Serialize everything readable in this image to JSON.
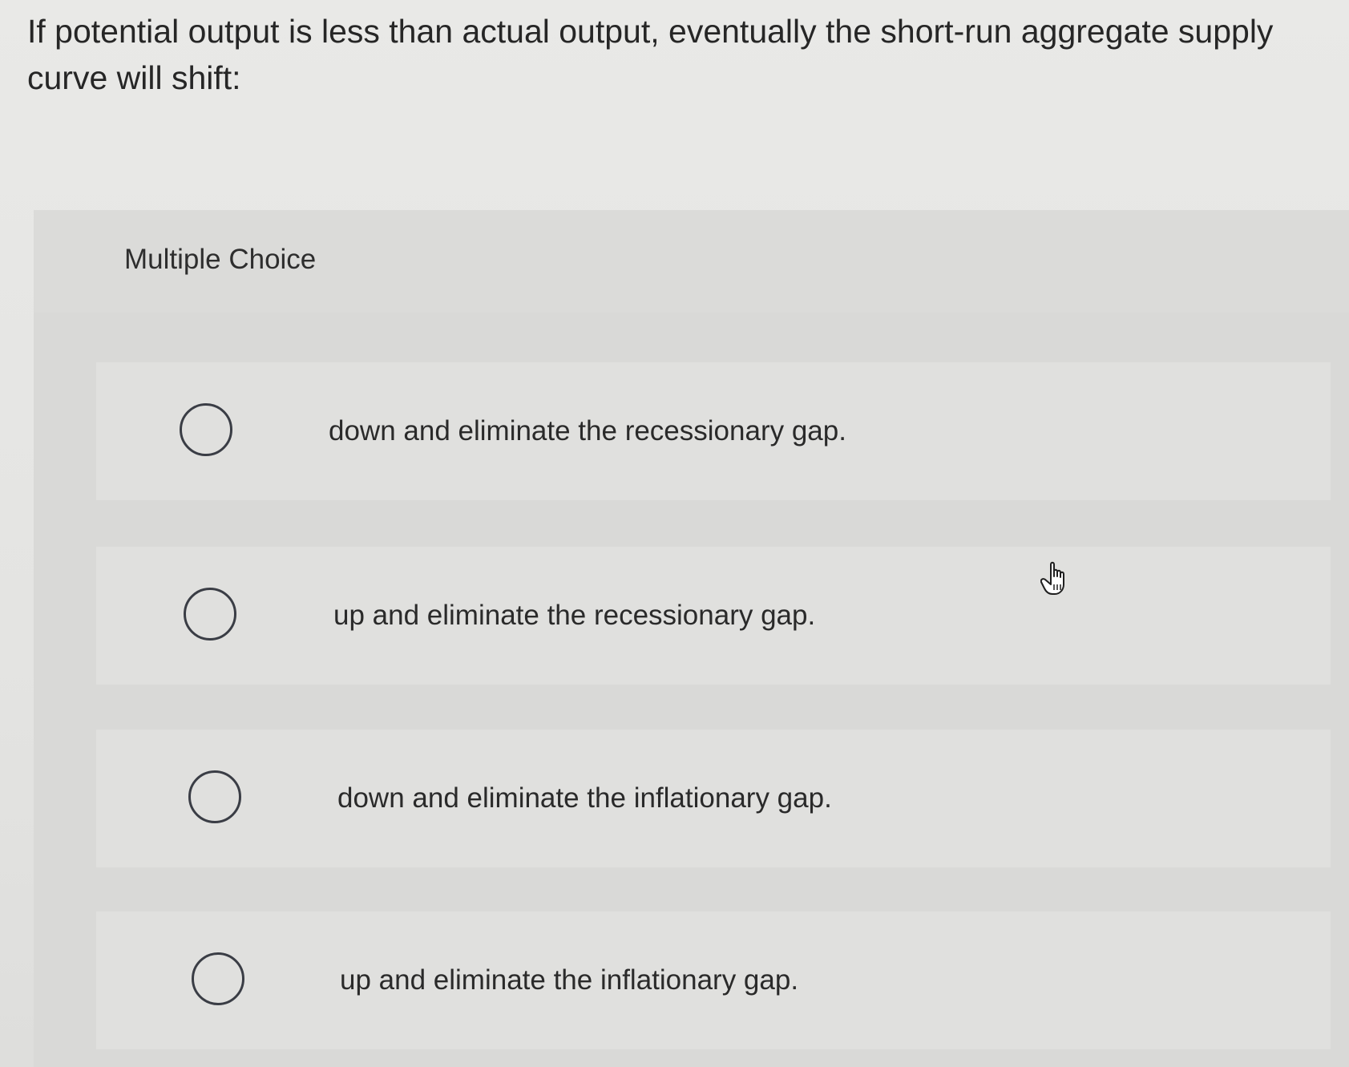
{
  "question": {
    "text": "If potential output is less than actual output, eventually the short-run aggregate supply curve will shift:"
  },
  "choice_section": {
    "header": "Multiple Choice",
    "options": [
      {
        "label": "down and eliminate the recessionary gap.",
        "selected": false
      },
      {
        "label": "up and eliminate the recessionary gap.",
        "selected": false
      },
      {
        "label": "down and eliminate the inflationary gap.",
        "selected": false
      },
      {
        "label": "up and eliminate the inflationary gap.",
        "selected": false
      }
    ]
  },
  "icons": {
    "radio": "radio-unselected-icon",
    "cursor": "hand-pointer-icon"
  },
  "colors": {
    "background": "#e6e6e4",
    "panel": "#dcdcda",
    "text": "#2b2b2b",
    "radio_border": "#3a3d45"
  }
}
